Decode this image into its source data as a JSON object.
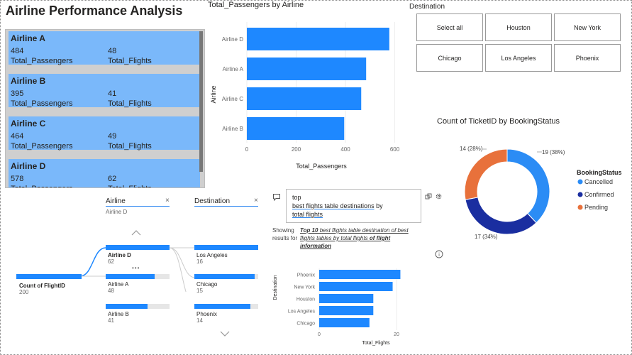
{
  "report_title": "Airline Performance Analysis",
  "card": {
    "records": [
      {
        "name": "Airline A",
        "passengers": "484",
        "passengers_label": "Total_Passengers",
        "flights": "48",
        "flights_label": "Total_Flights"
      },
      {
        "name": "Airline B",
        "passengers": "395",
        "passengers_label": "Total_Passengers",
        "flights": "41",
        "flights_label": "Total_Flights"
      },
      {
        "name": "Airline C",
        "passengers": "464",
        "passengers_label": "Total_Passengers",
        "flights": "49",
        "flights_label": "Total_Flights"
      },
      {
        "name": "Airline D",
        "passengers": "578",
        "passengers_label": "Total_Passengers",
        "flights": "62",
        "flights_label": "Total_Flights"
      }
    ]
  },
  "passengers_chart": {
    "title": "Total_Passengers by Airline",
    "xlabel": "Total_Passengers",
    "ylabel": "Airline",
    "ticks": [
      "0",
      "200",
      "400",
      "600"
    ]
  },
  "slicer": {
    "title": "Destination",
    "options": [
      "Select all",
      "Houston",
      "New York",
      "Chicago",
      "Los Angeles",
      "Phoenix"
    ]
  },
  "donut_chart": {
    "title": "Count of TicketID by BookingStatus",
    "legend_title": "BookingStatus",
    "labels": [
      "19 (38%)",
      "17 (34%)",
      "14 (28%)"
    ]
  },
  "decomp_tree": {
    "col1_header": "Airline",
    "col1_filter": "Airline D",
    "col2_header": "Destination",
    "close_glyph": "×",
    "root_label": "Count of FlightID",
    "root_value": "200",
    "airlines": [
      {
        "name": "Airline D",
        "value": "62",
        "fill": 1.0
      },
      {
        "name": "Airline A",
        "value": "48",
        "fill": 0.77
      },
      {
        "name": "Airline B",
        "value": "41",
        "fill": 0.66
      }
    ],
    "more_glyph": "•••",
    "destinations": [
      {
        "name": "Los Angeles",
        "value": "16",
        "fill": 1.0
      },
      {
        "name": "Chicago",
        "value": "15",
        "fill": 0.94
      },
      {
        "name": "Phoenix",
        "value": "14",
        "fill": 0.88
      }
    ]
  },
  "qa": {
    "line1": "top",
    "line2a": "best flights table destinations",
    "line2b": " by",
    "line3": "total flights",
    "showing": "Showing results for",
    "result_a": "Top 10",
    "result_b": " best flights table destination of best flights tables by total flights ",
    "result_c": "of flight information",
    "info_glyph": "i"
  },
  "qa_chart": {
    "xlabel": "Total_Flights",
    "ylabel": "Destination",
    "ticks": [
      "0",
      "20"
    ]
  },
  "colors": {
    "bar": "#1e88ff",
    "card_bg": "#7ab8fa",
    "cancelled": "#2b8cf5",
    "confirmed": "#1a2ea0",
    "pending": "#e8713b"
  },
  "chart_data": [
    {
      "type": "bar",
      "orientation": "horizontal",
      "title": "Total_Passengers by Airline",
      "xlabel": "Total_Passengers",
      "ylabel": "Airline",
      "categories": [
        "Airline D",
        "Airline A",
        "Airline C",
        "Airline B"
      ],
      "values": [
        578,
        484,
        464,
        395
      ],
      "xlim": [
        0,
        650
      ]
    },
    {
      "type": "pie",
      "variant": "donut",
      "title": "Count of TicketID by BookingStatus",
      "categories": [
        "Cancelled",
        "Confirmed",
        "Pending"
      ],
      "values": [
        19,
        17,
        14
      ],
      "legend_placement": "right"
    },
    {
      "type": "bar",
      "orientation": "horizontal",
      "xlabel": "Total_Flights",
      "ylabel": "Destination",
      "categories": [
        "Phoenix",
        "New York",
        "Houston",
        "Los Angeles",
        "Chicago"
      ],
      "values": [
        21,
        19,
        14,
        14,
        13
      ],
      "xlim": [
        0,
        25
      ]
    }
  ]
}
